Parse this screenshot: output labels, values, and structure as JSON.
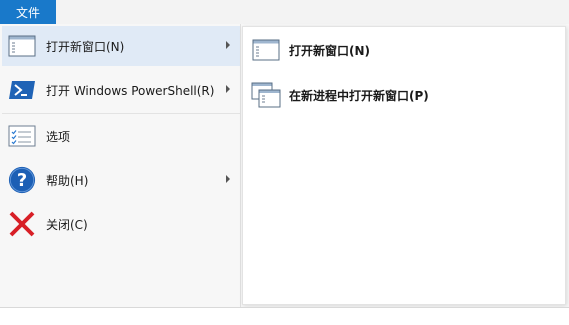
{
  "ribbon": {
    "file_tab_label": "文件",
    "accent_color": "#1979ca"
  },
  "file_menu": {
    "items": [
      {
        "icon": "new-window-icon",
        "label": "打开新窗口(N)",
        "has_submenu": true,
        "selected": true
      },
      {
        "icon": "powershell-icon",
        "label": "打开 Windows PowerShell(R)",
        "has_submenu": true,
        "selected": false
      },
      {
        "icon": "options-icon",
        "label": "选项",
        "has_submenu": false,
        "selected": false
      },
      {
        "icon": "help-icon",
        "label": "帮助(H)",
        "has_submenu": true,
        "selected": false
      },
      {
        "icon": "close-icon",
        "label": "关闭(C)",
        "has_submenu": false,
        "selected": false
      }
    ]
  },
  "submenu": {
    "items": [
      {
        "icon": "new-window-icon",
        "label": "打开新窗口(N)"
      },
      {
        "icon": "new-process-window-icon",
        "label": "在新进程中打开新窗口(P)"
      }
    ]
  }
}
